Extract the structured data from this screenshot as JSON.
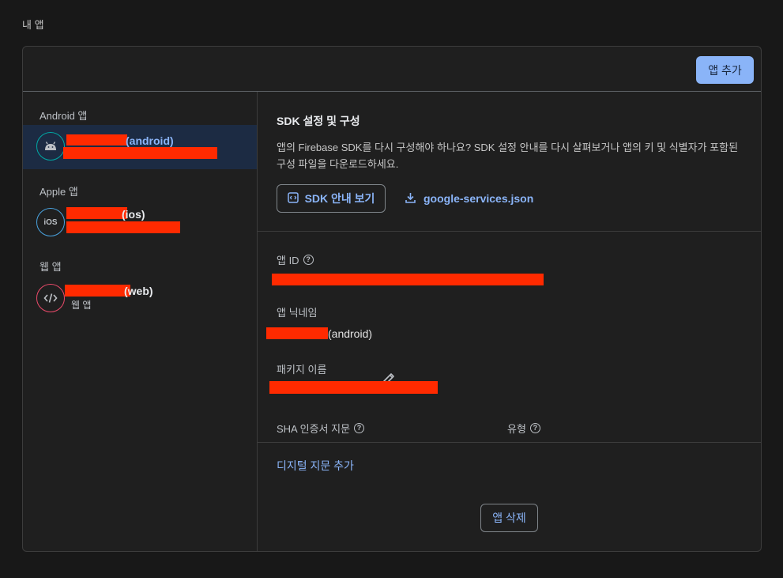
{
  "page": {
    "title": "내 앱"
  },
  "header": {
    "add_app_label": "앱 추가"
  },
  "sidebar": {
    "groups": [
      {
        "label": "Android 앱",
        "app": {
          "name_suffix": "(android)",
          "icon": "android-icon",
          "selected": true
        }
      },
      {
        "label": "Apple 앱",
        "app": {
          "name_suffix": "(ios)",
          "icon": "ios-icon",
          "selected": false
        }
      },
      {
        "label": "웹 앱",
        "app": {
          "name_suffix": "(web)",
          "subtitle": "웹 앱",
          "icon": "code-icon",
          "selected": false
        }
      }
    ]
  },
  "sdk": {
    "title": "SDK 설정 및 구성",
    "description": "앱의 Firebase SDK를 다시 구성해야 하나요? SDK 설정 안내를 다시 살펴보거나 앱의 키 및 식별자가 포함된 구성 파일을 다운로드하세요.",
    "guide_button": "SDK 안내 보기",
    "download_file": "google-services.json"
  },
  "details": {
    "app_id_label": "앱 ID",
    "nickname_label": "앱 닉네임",
    "nickname_suffix": "(android)",
    "package_label": "패키지 이름",
    "sha_label": "SHA 인증서 지문",
    "type_label": "유형",
    "add_fingerprint": "디지털 지문 추가",
    "delete_app": "앱 삭제"
  },
  "colors": {
    "accent": "#8ab4f8",
    "redaction": "#ff2a00",
    "selected_bg": "#1c2b43"
  }
}
